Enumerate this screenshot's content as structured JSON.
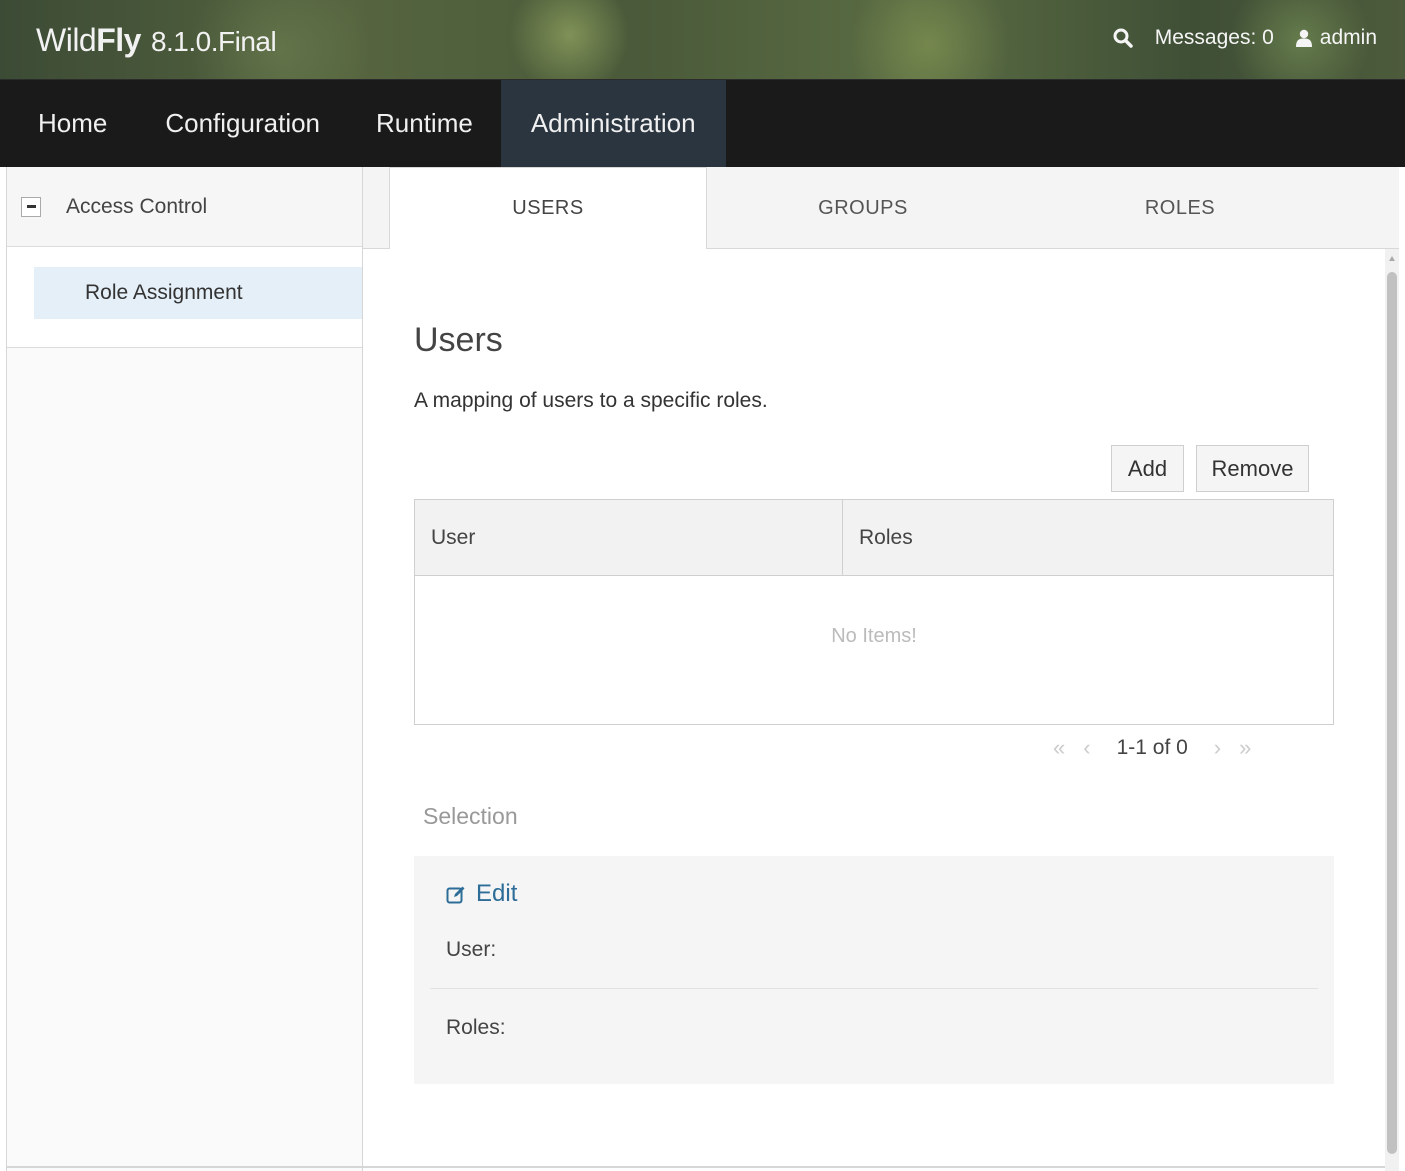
{
  "header": {
    "logo_wild": "Wild",
    "logo_fly": "Fly",
    "version": "8.1.0.Final",
    "messages_label": "Messages: 0",
    "user_label": "admin",
    "search_icon": "search-icon",
    "user_icon": "user-icon"
  },
  "nav": {
    "items": [
      {
        "label": "Home"
      },
      {
        "label": "Configuration"
      },
      {
        "label": "Runtime"
      },
      {
        "label": "Administration",
        "active": true
      }
    ]
  },
  "sidebar": {
    "section_label": "Access Control",
    "items": [
      {
        "label": "Role Assignment",
        "selected": true
      }
    ]
  },
  "subtabs": [
    {
      "label": "USERS",
      "active": true
    },
    {
      "label": "GROUPS"
    },
    {
      "label": "ROLES"
    }
  ],
  "main": {
    "title": "Users",
    "description": "A mapping of users to a specific roles.",
    "add_label": "Add",
    "remove_label": "Remove",
    "table": {
      "columns": [
        "User",
        "Roles"
      ],
      "empty_text": "No Items!"
    },
    "pager": {
      "first": "«",
      "prev": "‹",
      "info": "1-1 of 0",
      "next": "›",
      "last": "»"
    },
    "selection": {
      "heading": "Selection",
      "edit_label": "Edit",
      "user_label": "User:",
      "roles_label": "Roles:"
    }
  },
  "colors": {
    "nav_bg": "#1a1a1a",
    "nav_active_bg": "#2a3540",
    "link_blue": "#2d6d98",
    "sidebar_selected_bg": "#e4eff8"
  }
}
